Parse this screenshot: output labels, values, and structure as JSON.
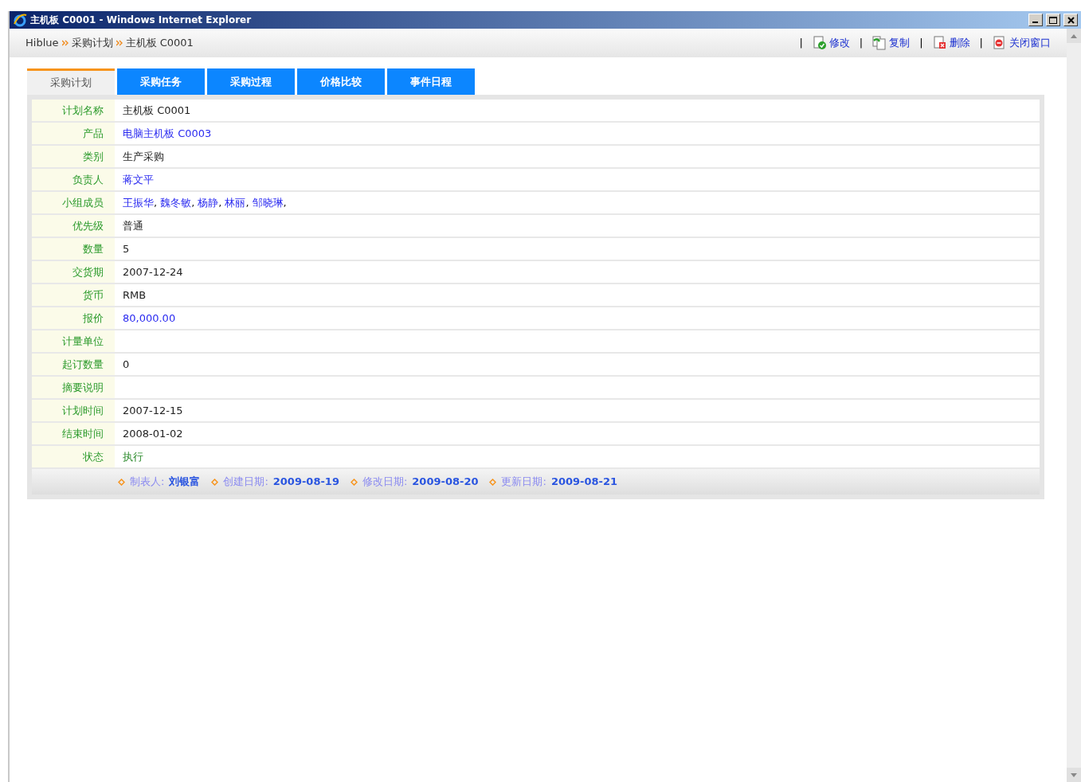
{
  "window": {
    "title": "主机板 C0001 - Windows Internet Explorer"
  },
  "breadcrumb": [
    "Hiblue",
    "采购计划",
    "主机板 C0001"
  ],
  "action_separator": "|",
  "member_separator": ",",
  "actions": [
    {
      "kind": "edit",
      "label": "修改"
    },
    {
      "kind": "copy",
      "label": "复制"
    },
    {
      "kind": "delete",
      "label": "删除"
    },
    {
      "kind": "close",
      "label": "关闭窗口"
    }
  ],
  "tabs": [
    {
      "label": "采购计划",
      "selected": true
    },
    {
      "label": "采购任务",
      "selected": false
    },
    {
      "label": "采购过程",
      "selected": false
    },
    {
      "label": "价格比较",
      "selected": false
    },
    {
      "label": "事件日程",
      "selected": false
    }
  ],
  "fields": [
    {
      "label": "计划名称",
      "kind": "text",
      "value": "主机板 C0001"
    },
    {
      "label": "产品",
      "kind": "link",
      "value": "电脑主机板 C0003"
    },
    {
      "label": "类别",
      "kind": "text",
      "value": "生产采购"
    },
    {
      "label": "负责人",
      "kind": "link",
      "value": "蒋文平"
    },
    {
      "label": "小组成员",
      "kind": "links",
      "values": [
        "王振华",
        "魏冬敏",
        "杨静",
        "林丽",
        "邹晓琳"
      ]
    },
    {
      "label": "优先级",
      "kind": "text",
      "value": "普通"
    },
    {
      "label": "数量",
      "kind": "text",
      "value": "5"
    },
    {
      "label": "交货期",
      "kind": "text",
      "value": "2007-12-24"
    },
    {
      "label": "货币",
      "kind": "text",
      "value": "RMB"
    },
    {
      "label": "报价",
      "kind": "link",
      "value": "80,000.00"
    },
    {
      "label": "计量单位",
      "kind": "empty"
    },
    {
      "label": "起订数量",
      "kind": "text",
      "value": "0"
    },
    {
      "label": "摘要说明",
      "kind": "empty"
    },
    {
      "label": "计划时间",
      "kind": "text",
      "value": "2007-12-15"
    },
    {
      "label": "结束时间",
      "kind": "text",
      "value": "2008-01-02"
    },
    {
      "label": "状态",
      "kind": "status",
      "value": "执行"
    }
  ],
  "footer": [
    {
      "label": "制表人:",
      "value": "刘银富"
    },
    {
      "label": "创建日期:",
      "value": "2009-08-19"
    },
    {
      "label": "修改日期:",
      "value": "2009-08-20"
    },
    {
      "label": "更新日期:",
      "value": "2009-08-21"
    }
  ]
}
